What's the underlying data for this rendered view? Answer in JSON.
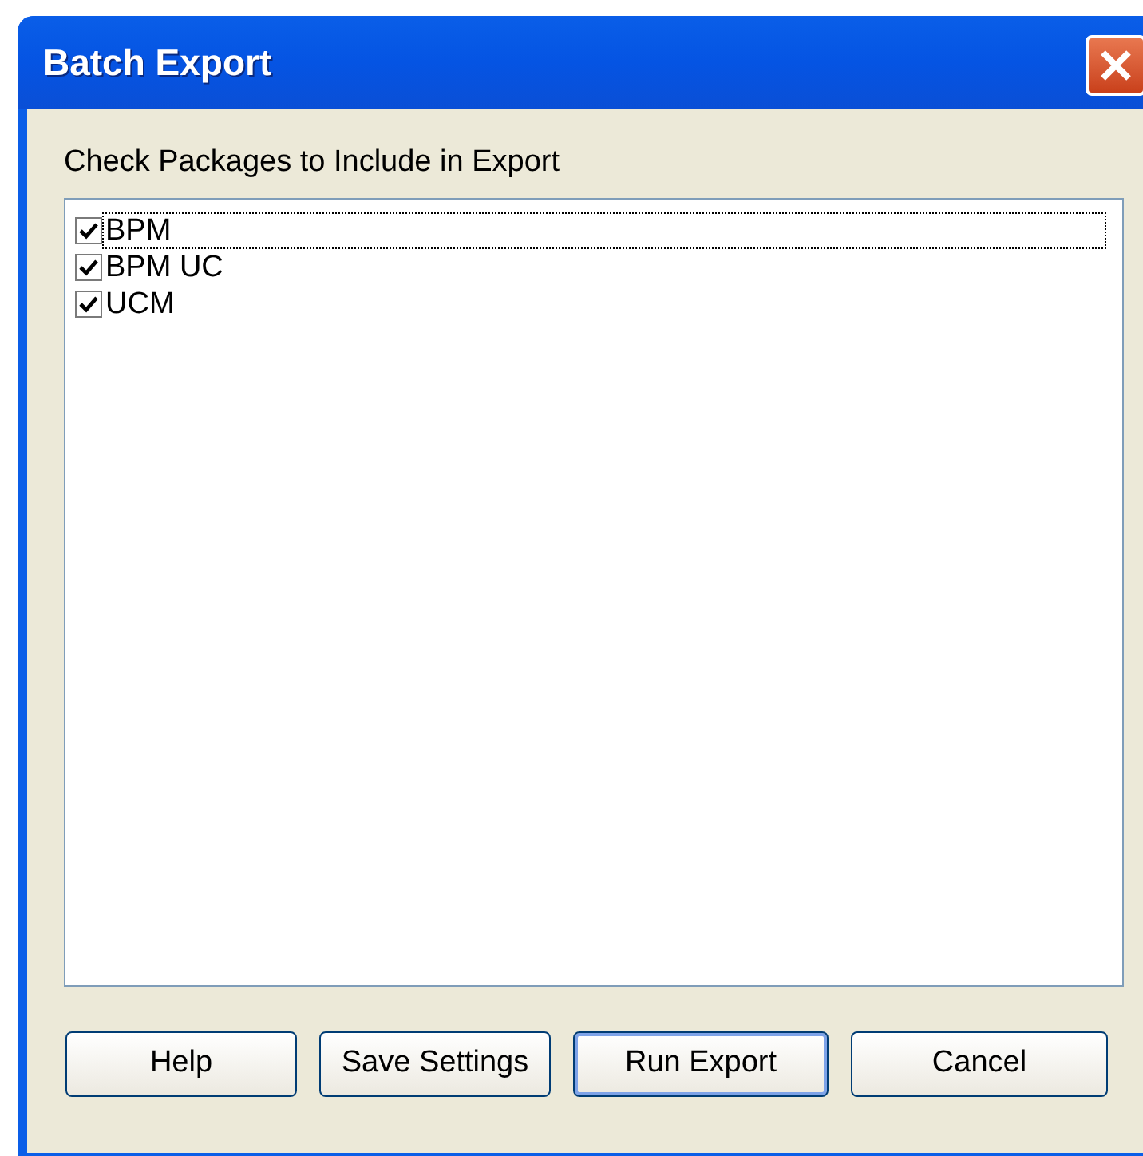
{
  "window": {
    "title": "Batch Export"
  },
  "instruction": "Check Packages to Include in Export",
  "packages": [
    {
      "label": "BPM",
      "checked": true,
      "focused": true
    },
    {
      "label": "BPM UC",
      "checked": true,
      "focused": false
    },
    {
      "label": "UCM",
      "checked": true,
      "focused": false
    }
  ],
  "buttons": [
    {
      "label": "Help",
      "default": false
    },
    {
      "label": "Save Settings",
      "default": false
    },
    {
      "label": "Run Export",
      "default": true
    },
    {
      "label": "Cancel",
      "default": false
    }
  ]
}
